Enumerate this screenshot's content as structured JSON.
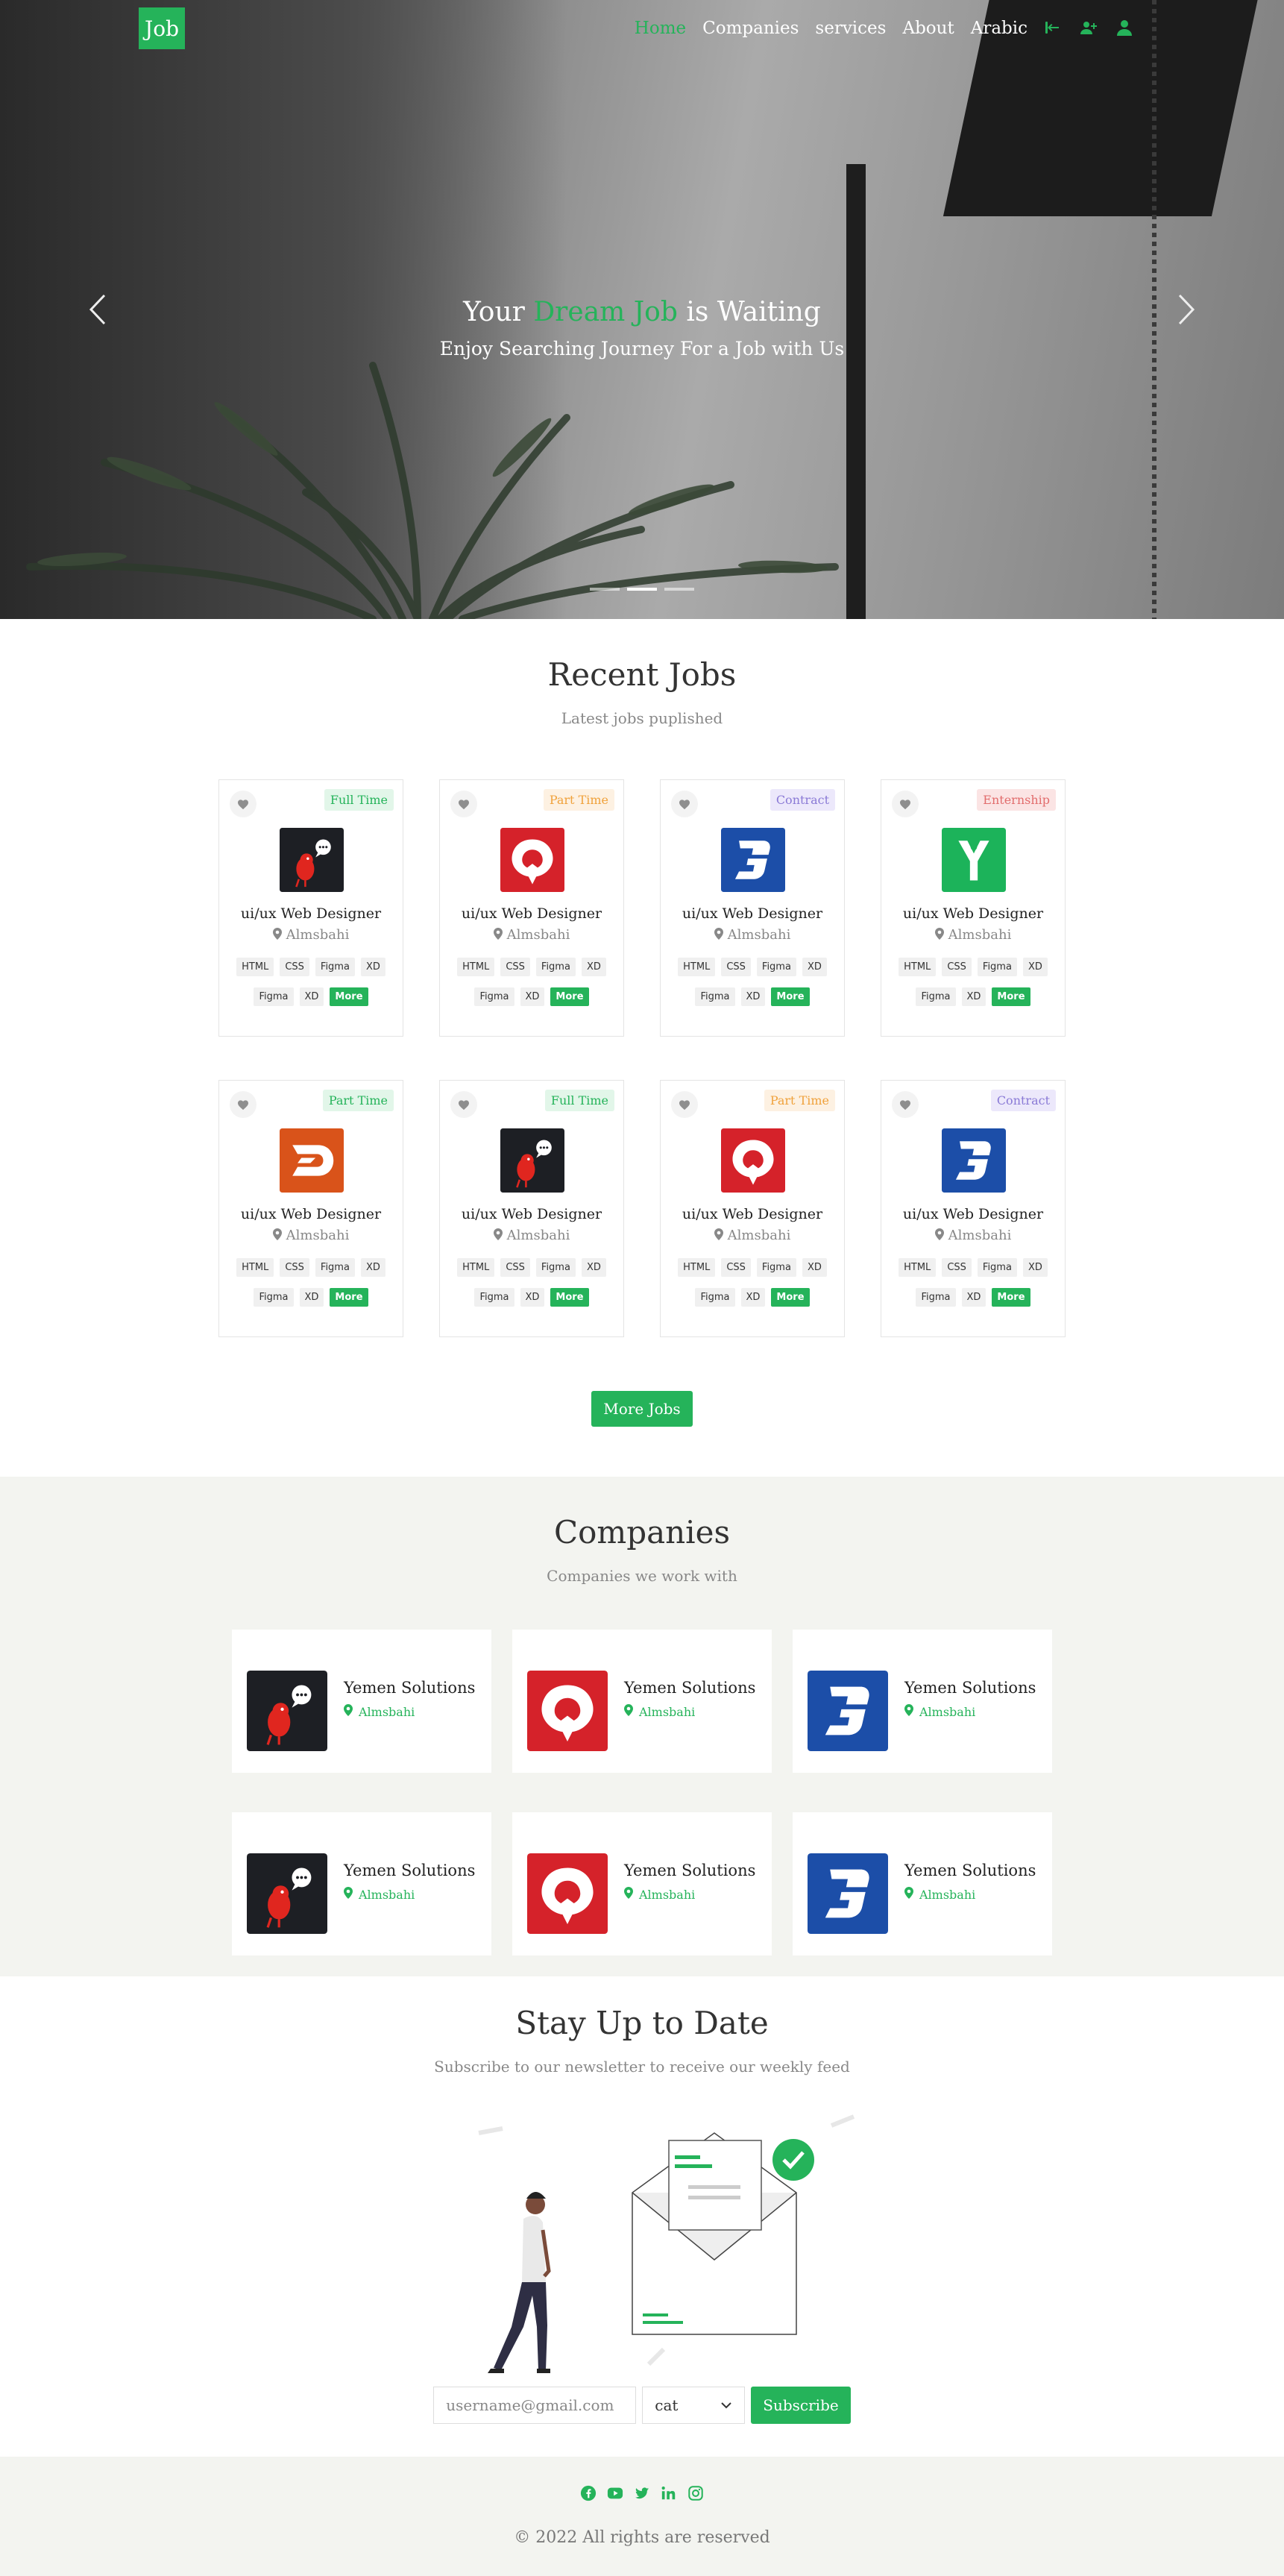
{
  "nav": {
    "logo": "Job",
    "items": [
      {
        "label": "Home",
        "active": true
      },
      {
        "label": "Companies",
        "active": false
      },
      {
        "label": "services",
        "active": false
      },
      {
        "label": "About",
        "active": false
      },
      {
        "label": "Arabic",
        "active": false
      }
    ],
    "icons": [
      "login-icon",
      "add-user-icon",
      "user-icon"
    ]
  },
  "hero": {
    "title_prefix": "Your",
    "title_accent": "Dream Job",
    "title_suffix": "is Waiting",
    "subtitle": "Enjoy Searching Journey For a Job with Us",
    "slides": 3,
    "active_slide": 2
  },
  "recent_jobs": {
    "title": "Recent Jobs",
    "subtitle": "Latest jobs puplished",
    "jobs": [
      {
        "type": "Full Time",
        "type_class": "t-full",
        "logo": "bird",
        "title": "ui/ux Web Designer",
        "location": "Almsbahi",
        "tags_row1": [
          "HTML",
          "CSS",
          "Figma",
          "XD"
        ],
        "tags_row2": [
          "Figma",
          "XD"
        ],
        "more": "More"
      },
      {
        "type": "Part Time",
        "type_class": "t-part",
        "logo": "red-bubble",
        "title": "ui/ux Web Designer",
        "location": "Almsbahi",
        "tags_row1": [
          "HTML",
          "CSS",
          "Figma",
          "XD"
        ],
        "tags_row2": [
          "Figma",
          "XD"
        ],
        "more": "More"
      },
      {
        "type": "Contract",
        "type_class": "t-contract",
        "logo": "blue-d",
        "title": "ui/ux Web Designer",
        "location": "Almsbahi",
        "tags_row1": [
          "HTML",
          "CSS",
          "Figma",
          "XD"
        ],
        "tags_row2": [
          "Figma",
          "XD"
        ],
        "more": "More"
      },
      {
        "type": "Enternship",
        "type_class": "t-intern",
        "logo": "green-y",
        "title": "ui/ux Web Designer",
        "location": "Almsbahi",
        "tags_row1": [
          "HTML",
          "CSS",
          "Figma",
          "XD"
        ],
        "tags_row2": [
          "Figma",
          "XD"
        ],
        "more": "More"
      },
      {
        "type": "Part Time",
        "type_class": "t-full",
        "logo": "orange-d",
        "title": "ui/ux Web Designer",
        "location": "Almsbahi",
        "tags_row1": [
          "HTML",
          "CSS",
          "Figma",
          "XD"
        ],
        "tags_row2": [
          "Figma",
          "XD"
        ],
        "more": "More"
      },
      {
        "type": "Full Time",
        "type_class": "t-full",
        "logo": "bird",
        "title": "ui/ux Web Designer",
        "location": "Almsbahi",
        "tags_row1": [
          "HTML",
          "CSS",
          "Figma",
          "XD"
        ],
        "tags_row2": [
          "Figma",
          "XD"
        ],
        "more": "More"
      },
      {
        "type": "Part Time",
        "type_class": "t-part",
        "logo": "red-bubble",
        "title": "ui/ux Web Designer",
        "location": "Almsbahi",
        "tags_row1": [
          "HTML",
          "CSS",
          "Figma",
          "XD"
        ],
        "tags_row2": [
          "Figma",
          "XD"
        ],
        "more": "More"
      },
      {
        "type": "Contract",
        "type_class": "t-contract",
        "logo": "blue-d",
        "title": "ui/ux Web Designer",
        "location": "Almsbahi",
        "tags_row1": [
          "HTML",
          "CSS",
          "Figma",
          "XD"
        ],
        "tags_row2": [
          "Figma",
          "XD"
        ],
        "more": "More"
      }
    ],
    "more_button": "More Jobs"
  },
  "companies": {
    "title": "Companies",
    "subtitle": "Companies we work with",
    "items": [
      {
        "name": "Yemen Solutions",
        "location": "Almsbahi",
        "logo": "bird"
      },
      {
        "name": "Yemen Solutions",
        "location": "Almsbahi",
        "logo": "red-bubble"
      },
      {
        "name": "Yemen Solutions",
        "location": "Almsbahi",
        "logo": "blue-d"
      },
      {
        "name": "Yemen Solutions",
        "location": "Almsbahi",
        "logo": "bird"
      },
      {
        "name": "Yemen Solutions",
        "location": "Almsbahi",
        "logo": "red-bubble"
      },
      {
        "name": "Yemen Solutions",
        "location": "Almsbahi",
        "logo": "blue-d"
      }
    ]
  },
  "newsletter": {
    "title": "Stay Up to Date",
    "subtitle": "Subscribe to our newsletter to receive our weekly feed",
    "email_placeholder": "username@gmail.com",
    "category_value": "cat",
    "subscribe_label": "Subscribe"
  },
  "footer": {
    "social_icons": [
      "facebook-icon",
      "youtube-icon",
      "twitter-icon",
      "linkedin-icon",
      "instagram-icon"
    ],
    "copyright": "© 2022 All rights are reserved"
  },
  "colors": {
    "accent": "#25b35a",
    "light_bg": "#f3f4f0"
  }
}
